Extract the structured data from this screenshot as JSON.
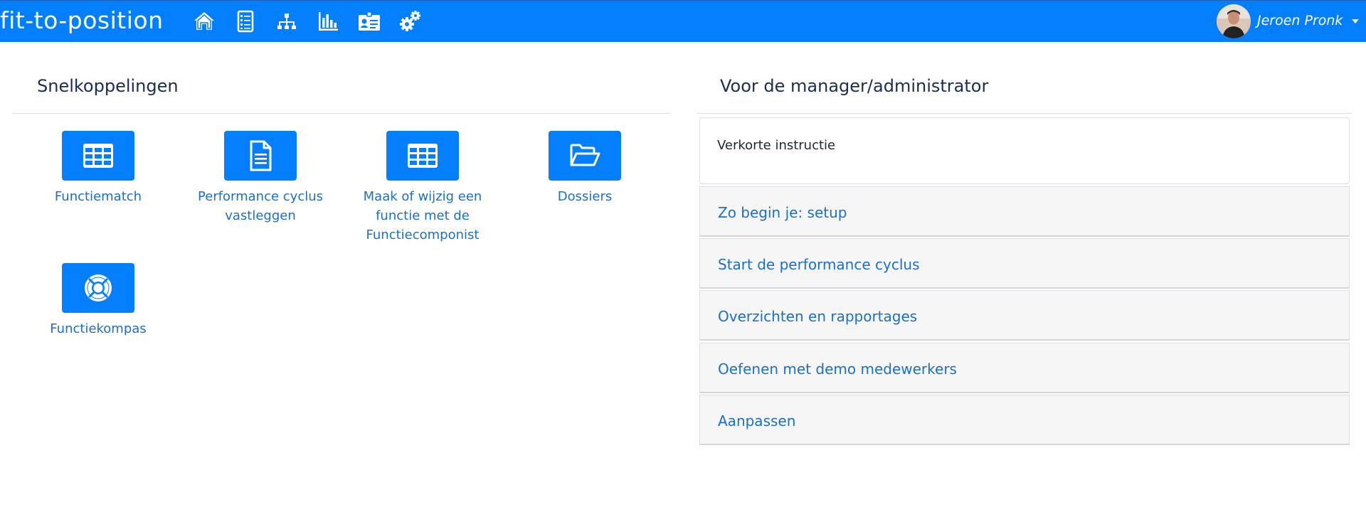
{
  "brand": {
    "name": "fit-to-position"
  },
  "nav": {
    "icons": [
      "home-icon",
      "checklist-icon",
      "org-chart-icon",
      "bar-chart-icon",
      "id-card-icon",
      "gears-icon"
    ]
  },
  "user": {
    "name": "Jeroen Pronk"
  },
  "colors": {
    "primary": "#037ffe",
    "link": "#1b70c4",
    "heading": "#1b2e4e",
    "panel_bg": "#f6f6f6"
  },
  "shortcuts": {
    "title": "Snelkoppelingen",
    "tiles": [
      {
        "icon": "grid-icon",
        "label": "Functiematch"
      },
      {
        "icon": "document-icon",
        "label": "Performance cyclus vastleggen"
      },
      {
        "icon": "grid-icon",
        "label": "Maak of wijzig een functie met de Functiecomponist"
      },
      {
        "icon": "folder-open-icon",
        "label": "Dossiers"
      },
      {
        "icon": "lifebuoy-icon",
        "label": "Functiekompas"
      }
    ]
  },
  "manager": {
    "title": "Voor de manager/administrator",
    "intro": "Verkorte instructie",
    "items": [
      "Zo begin je: setup",
      "Start de performance cyclus",
      "Overzichten en rapportages",
      "Oefenen met demo medewerkers",
      "Aanpassen"
    ]
  }
}
